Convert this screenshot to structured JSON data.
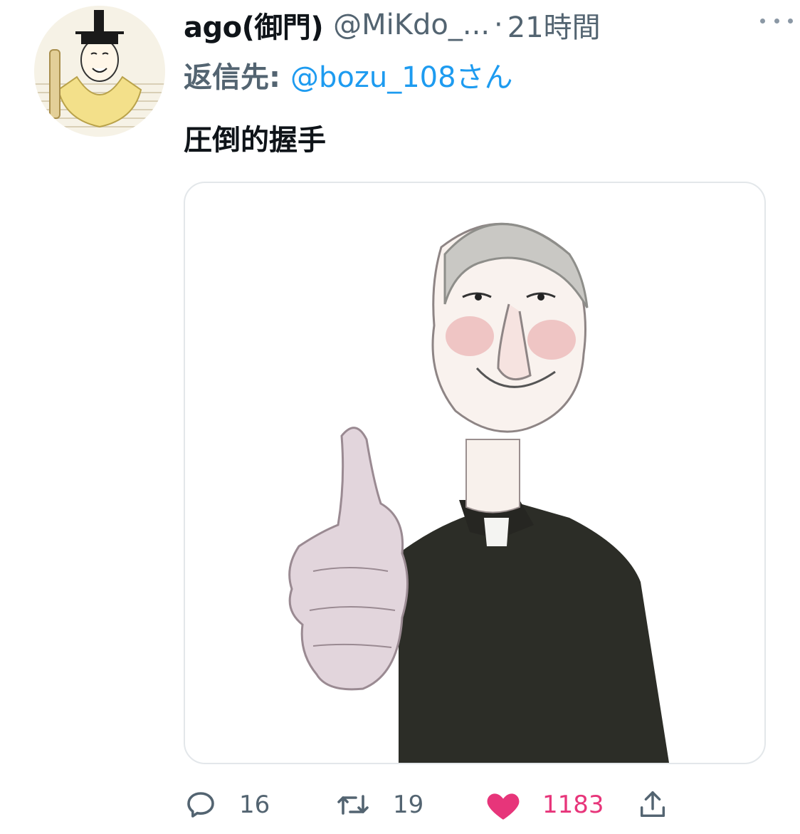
{
  "tweet": {
    "display_name": "ago(御門)",
    "handle": "@MiKdo_...",
    "separator": "·",
    "time": "21時間",
    "reply_label": "返信先:",
    "reply_handle": "@bozu_108さん",
    "text": "圧倒的握手"
  },
  "actions": {
    "reply_count": "16",
    "retweet_count": "19",
    "like_count": "1183"
  },
  "colors": {
    "accent_blue": "#1d9bf0",
    "like_pink": "#e7357a",
    "secondary_text": "#536471"
  },
  "icons": {
    "reply": "reply-icon",
    "retweet": "retweet-icon",
    "like": "heart-icon",
    "share": "share-icon",
    "more": "more-options-icon"
  }
}
